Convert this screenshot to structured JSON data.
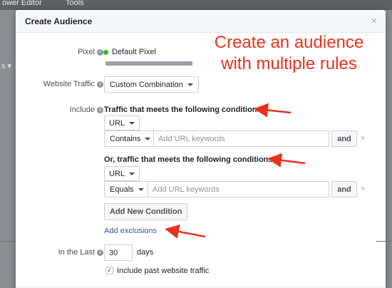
{
  "background": {
    "top_items": [
      "ower Editor",
      "Tools"
    ],
    "left_fragment": "s"
  },
  "modal": {
    "title": "Create Audience",
    "close_label": "×"
  },
  "pixel": {
    "label": "Pixel",
    "name": "Default Pixel",
    "status_color": "#42b72a"
  },
  "website_traffic": {
    "label": "Website Traffic",
    "selected": "Custom Combination"
  },
  "include": {
    "label": "Include",
    "rule_groups": [
      {
        "heading": "Traffic that meets the following conditions:",
        "field": "URL",
        "operator": "Contains",
        "placeholder": "Add URL keywords",
        "and_label": "and",
        "remove_label": "×"
      },
      {
        "heading": "Or, traffic that meets the following conditions:",
        "field": "URL",
        "operator": "Equals",
        "placeholder": "Add URL keywords",
        "and_label": "and",
        "remove_label": "×"
      }
    ],
    "add_condition_label": "Add New Condition",
    "add_exclusions_label": "Add exclusions"
  },
  "in_the_last": {
    "label": "In the Last",
    "value": "30",
    "unit": "days"
  },
  "include_past": {
    "label": "Include past website traffic",
    "checked": true
  },
  "annotation": {
    "text_line1": "Create an audience",
    "text_line2": "with multiple rules",
    "color": "#e8321e"
  }
}
